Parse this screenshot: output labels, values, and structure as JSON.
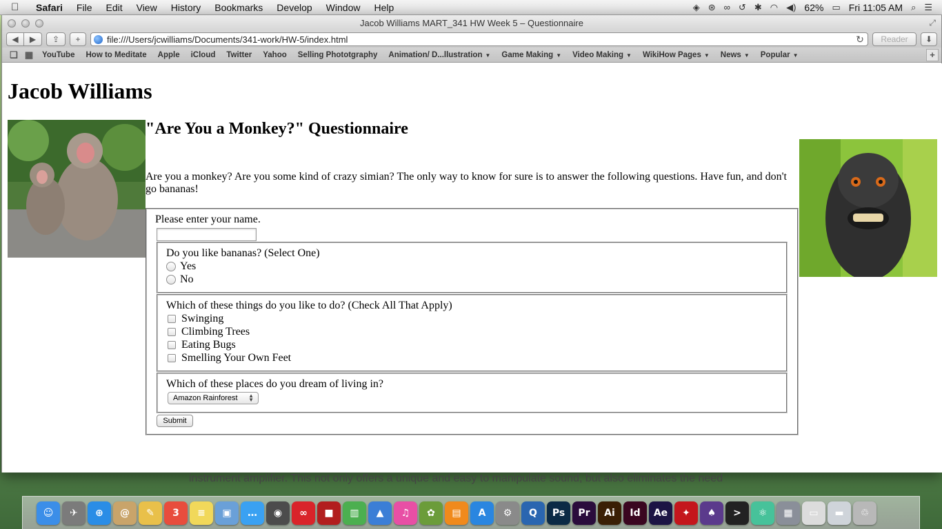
{
  "menubar": {
    "app": "Safari",
    "items": [
      "File",
      "Edit",
      "View",
      "History",
      "Bookmarks",
      "Develop",
      "Window",
      "Help"
    ],
    "battery": "62%",
    "clock": "Fri 11:05 AM"
  },
  "window": {
    "title": "Jacob Williams MART_341 HW Week 5 – Questionnaire",
    "url": "file:///Users/jcwilliams/Documents/341-work/HW-5/index.html",
    "reader_label": "Reader"
  },
  "bookmarks": [
    {
      "label": "YouTube",
      "menu": false
    },
    {
      "label": "How to Meditate",
      "menu": false
    },
    {
      "label": "Apple",
      "menu": false
    },
    {
      "label": "iCloud",
      "menu": false
    },
    {
      "label": "Twitter",
      "menu": false
    },
    {
      "label": "Yahoo",
      "menu": false
    },
    {
      "label": "Selling Phototgraphy",
      "menu": false
    },
    {
      "label": "Animation/ D...llustration",
      "menu": true
    },
    {
      "label": "Game Making",
      "menu": true
    },
    {
      "label": "Video Making",
      "menu": true
    },
    {
      "label": "WikiHow Pages",
      "menu": true
    },
    {
      "label": "News",
      "menu": true
    },
    {
      "label": "Popular",
      "menu": true
    }
  ],
  "page": {
    "author": "Jacob Williams",
    "questionnaire_title": "\"Are You a Monkey?\" Questionnaire",
    "intro": "Are you a monkey? Are you some kind of crazy simian? The only way to know for sure is to answer the following questions. Have fun, and don't go bananas!",
    "name_label": "Please enter your name.",
    "name_value": "",
    "q1": {
      "legend": "Do you like bananas? (Select One)",
      "options": [
        "Yes",
        "No"
      ]
    },
    "q2": {
      "legend": "Which of these things do you like to do? (Check All That Apply)",
      "options": [
        "Swinging",
        "Climbing Trees",
        "Eating Bugs",
        "Smelling Your Own Feet"
      ]
    },
    "q3": {
      "legend": "Which of these places do you dream of living in?",
      "selected": "Amazon Rainforest"
    },
    "submit_label": "Submit"
  },
  "background_text": "instrument amplifier. This not only offers a unique and easy to manipulate sound, but also eliminates the need",
  "dock": [
    {
      "icon": "finder-icon",
      "glyph": "☺",
      "color": "#3b8ee8"
    },
    {
      "icon": "launchpad-icon",
      "glyph": "✈",
      "color": "#7b7b7b"
    },
    {
      "icon": "safari-icon",
      "glyph": "⊕",
      "color": "#2a8de6"
    },
    {
      "icon": "contacts-icon",
      "glyph": "@",
      "color": "#c9a46a"
    },
    {
      "icon": "textedit-icon",
      "glyph": "✎",
      "color": "#e9c04a"
    },
    {
      "icon": "calendar-icon",
      "glyph": "3",
      "color": "#e84d3d"
    },
    {
      "icon": "notes-icon",
      "glyph": "≡",
      "color": "#f1d85a"
    },
    {
      "icon": "preview-icon",
      "glyph": "▣",
      "color": "#6aa0d8"
    },
    {
      "icon": "messages-icon",
      "glyph": "…",
      "color": "#3aa1f2"
    },
    {
      "icon": "facetime-icon",
      "glyph": "◉",
      "color": "#4c4c4c"
    },
    {
      "icon": "creative-cloud-icon",
      "glyph": "∞",
      "color": "#d9242a"
    },
    {
      "icon": "photo-booth-icon",
      "glyph": "■",
      "color": "#b21e1e"
    },
    {
      "icon": "numbers-icon",
      "glyph": "▥",
      "color": "#4caf50"
    },
    {
      "icon": "keynote-icon",
      "glyph": "▲",
      "color": "#3b7ed6"
    },
    {
      "icon": "itunes-icon",
      "glyph": "♫",
      "color": "#e84fa5"
    },
    {
      "icon": "iphoto-icon",
      "glyph": "✿",
      "color": "#6b9c3a"
    },
    {
      "icon": "ibooks-icon",
      "glyph": "▤",
      "color": "#f08a1c"
    },
    {
      "icon": "app-store-icon",
      "glyph": "A",
      "color": "#2a86e0"
    },
    {
      "icon": "system-preferences-icon",
      "glyph": "⚙",
      "color": "#8a8a8a"
    },
    {
      "icon": "quicktime-icon",
      "glyph": "Q",
      "color": "#2a66b0"
    },
    {
      "icon": "photoshop-icon",
      "glyph": "Ps",
      "color": "#0b2a45"
    },
    {
      "icon": "premiere-icon",
      "glyph": "Pr",
      "color": "#2a0c3c"
    },
    {
      "icon": "illustrator-icon",
      "glyph": "Ai",
      "color": "#3a1f05"
    },
    {
      "icon": "indesign-icon",
      "glyph": "Id",
      "color": "#3a0620"
    },
    {
      "icon": "after-effects-icon",
      "glyph": "Ae",
      "color": "#1c1444"
    },
    {
      "icon": "acrobat-icon",
      "glyph": "✦",
      "color": "#c4161c"
    },
    {
      "icon": "github-icon",
      "glyph": "♠",
      "color": "#5b3a8c"
    },
    {
      "icon": "terminal-icon",
      "glyph": "&gt;",
      "color": "#222222"
    },
    {
      "icon": "atom-icon",
      "glyph": "⚛",
      "color": "#47c29a"
    },
    {
      "icon": "folder-icon",
      "glyph": "▦",
      "color": "#8a8f99"
    },
    {
      "icon": "documents-icon",
      "glyph": "▭",
      "color": "#dcdcdc"
    },
    {
      "icon": "downloads-icon",
      "glyph": "▬",
      "color": "#cfd4da"
    },
    {
      "icon": "trash-icon",
      "glyph": "♲",
      "color": "#b8b8b8"
    }
  ]
}
